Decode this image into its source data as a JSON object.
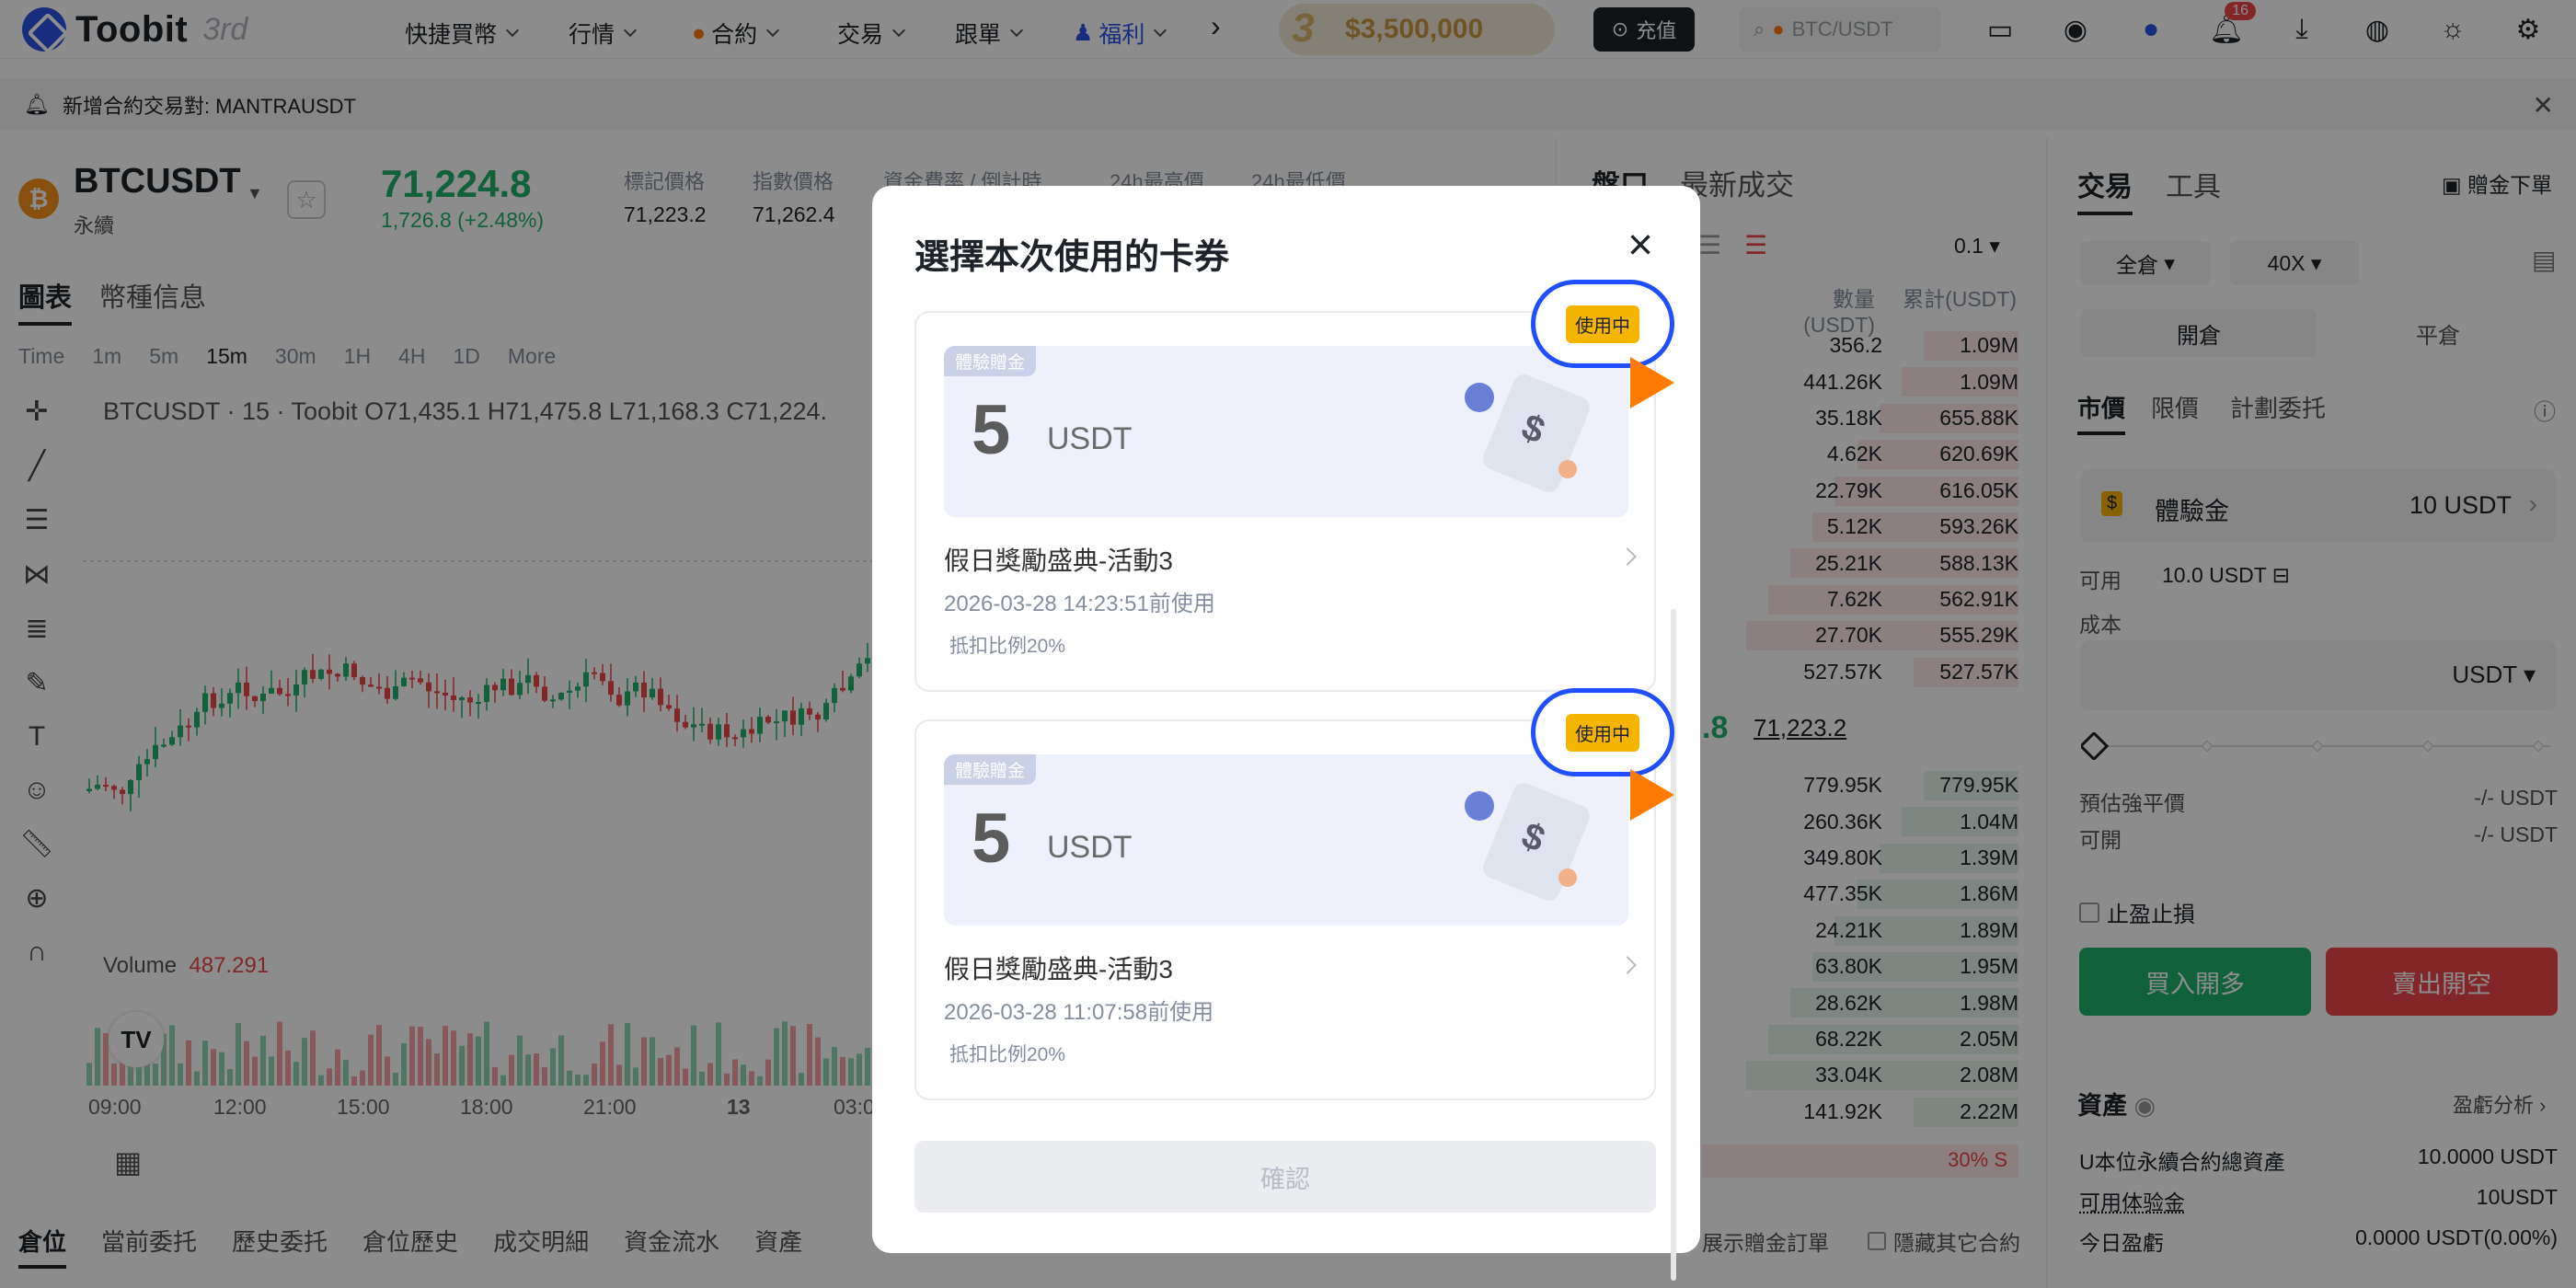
{
  "nav": {
    "logo": "Toobit",
    "logo_sup": "3rd",
    "items": [
      "快捷買幣",
      "行情",
      "合約",
      "交易",
      "跟單",
      "福利"
    ],
    "promo_amount": "$3,500,000",
    "deposit_label": "充值",
    "search_placeholder": "BTC/USDT",
    "notif_count": "16"
  },
  "announcement": {
    "text": "新增合約交易對: MANTRAUSDT"
  },
  "ticker": {
    "symbol": "BTCUSDT",
    "subtitle": "永續",
    "last_price": "71,224.8",
    "change": "1,726.8 (+2.48%)",
    "stats": [
      {
        "label": "標記價格",
        "value": "71,223.2"
      },
      {
        "label": "指數價格",
        "value": "71,262.4"
      },
      {
        "label": "資金費率 / 倒計時",
        "value": ""
      },
      {
        "label": "24h最高價",
        "value": ""
      },
      {
        "label": "24h最低價",
        "value": ""
      }
    ]
  },
  "chart_tabs": [
    "圖表",
    "幣種信息"
  ],
  "timeframes": [
    "Time",
    "1m",
    "5m",
    "15m",
    "30m",
    "1H",
    "4H",
    "1D",
    "More"
  ],
  "chart_info": {
    "ohlc": "BTCUSDT · 15 · Toobit  O71,435.1  H71,475.8  L71,168.3  C71,224.",
    "volume_label": "Volume",
    "volume_value": "487.291",
    "x_ticks": [
      "09:00",
      "12:00",
      "15:00",
      "18:00",
      "21:00",
      "13",
      "03:0"
    ]
  },
  "bottom_tabs": [
    "倉位",
    "當前委托",
    "歷史委托",
    "倉位歷史",
    "成交明細",
    "資金流水",
    "資產"
  ],
  "bottom_right": [
    "展示贈金訂單",
    "隱藏其它合約"
  ],
  "orderbook": {
    "tabs": [
      "盤口",
      "最新成交"
    ],
    "precision": "0.1",
    "headers": [
      "數量(USDT)",
      "累計(USDT)"
    ],
    "asks": [
      [
        "356.2",
        "1.09M"
      ],
      [
        "441.26K",
        "1.09M"
      ],
      [
        "35.18K",
        "655.88K"
      ],
      [
        "4.62K",
        "620.69K"
      ],
      [
        "22.79K",
        "616.05K"
      ],
      [
        "5.12K",
        "593.26K"
      ],
      [
        "25.21K",
        "588.13K"
      ],
      [
        "7.62K",
        "562.91K"
      ],
      [
        "27.70K",
        "555.29K"
      ],
      [
        "527.57K",
        "527.57K"
      ]
    ],
    "mid_price": ".8",
    "mid_mark": "71,223.2",
    "bids": [
      [
        "779.95K",
        "779.95K"
      ],
      [
        "260.36K",
        "1.04M"
      ],
      [
        "349.80K",
        "1.39M"
      ],
      [
        "477.35K",
        "1.86M"
      ],
      [
        "24.21K",
        "1.89M"
      ],
      [
        "63.80K",
        "1.95M"
      ],
      [
        "28.62K",
        "1.98M"
      ],
      [
        "68.22K",
        "2.05M"
      ],
      [
        "33.04K",
        "2.08M"
      ],
      [
        "141.92K",
        "2.22M"
      ]
    ],
    "ratio_sell": "30% S"
  },
  "trade_panel": {
    "tabs": [
      "交易",
      "工具"
    ],
    "gift_order": "贈金下單",
    "margin_mode": "全倉",
    "leverage": "40X",
    "open": "開倉",
    "close": "平倉",
    "order_types": [
      "市價",
      "限價",
      "計劃委托"
    ],
    "voucher_label": "體驗金",
    "voucher_value": "10 USDT",
    "available_label": "可用",
    "available_value": "10.0 USDT",
    "cost_label": "成本",
    "cost_unit": "USDT",
    "liq_label": "預估強平價",
    "liq_value": "-/- USDT",
    "avail2_label": "可開",
    "avail2_value": "-/- USDT",
    "tpsl_label": "止盈止損",
    "buy_label": "買入開多",
    "sell_label": "賣出開空",
    "assets_title": "資產",
    "pnl_link": "盈虧分析",
    "asset_rows": [
      {
        "label": "U本位永續合約總資產",
        "value": "10.0000 USDT"
      },
      {
        "label": "可用体验金",
        "value": "10USDT"
      },
      {
        "label": "今日盈虧",
        "value": "0.0000 USDT(0.00%)"
      }
    ]
  },
  "modal": {
    "title": "選擇本次使用的卡券",
    "cards": [
      {
        "tag": "體驗贈金",
        "amount": "5",
        "unit": "USDT",
        "name": "假日獎勵盛典-活動3",
        "expiry": "2026-03-28 14:23:51前使用",
        "ratio": "抵扣比例20%",
        "status": "使用中"
      },
      {
        "tag": "體驗贈金",
        "amount": "5",
        "unit": "USDT",
        "name": "假日獎勵盛典-活動3",
        "expiry": "2026-03-28 11:07:58前使用",
        "ratio": "抵扣比例20%",
        "status": "使用中"
      }
    ],
    "confirm_label": "確認"
  },
  "colors": {
    "up": "#20b26c",
    "down": "#ef454a",
    "brand": "#2b54e6",
    "badge": "#f5b400",
    "highlight_ring": "#1f4fff",
    "pointer": "#ff7a00"
  }
}
